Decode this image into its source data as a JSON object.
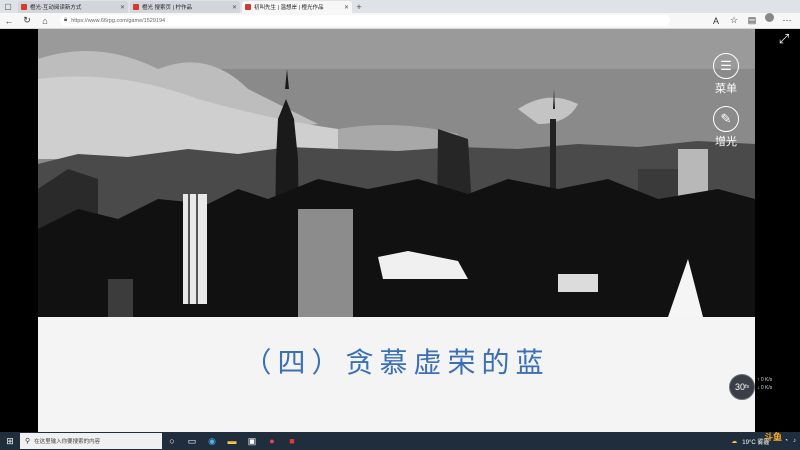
{
  "browser": {
    "tabs": [
      {
        "label": "橙光-互动阅读新方式",
        "active": false
      },
      {
        "label": "橙光 搜索页 | 柠作品",
        "active": false
      },
      {
        "label": "初叫先生 | 温想岸 | 橙光作品",
        "active": true
      }
    ],
    "new_tab": "+",
    "address": "https://www.66rpg.com/game/1529194"
  },
  "game": {
    "caption": "（四）贪慕虚荣的蓝",
    "menu_button": "菜单",
    "light_button": "增光",
    "fps": "30",
    "fps_unit": "fs",
    "net_up": "↑ 0 K/s",
    "net_down": "↓ 0 K/s"
  },
  "taskbar": {
    "search_placeholder": "在这里输入你要搜索的内容",
    "weather": "19°C 雾霾",
    "logo_text": "斗鱼"
  }
}
